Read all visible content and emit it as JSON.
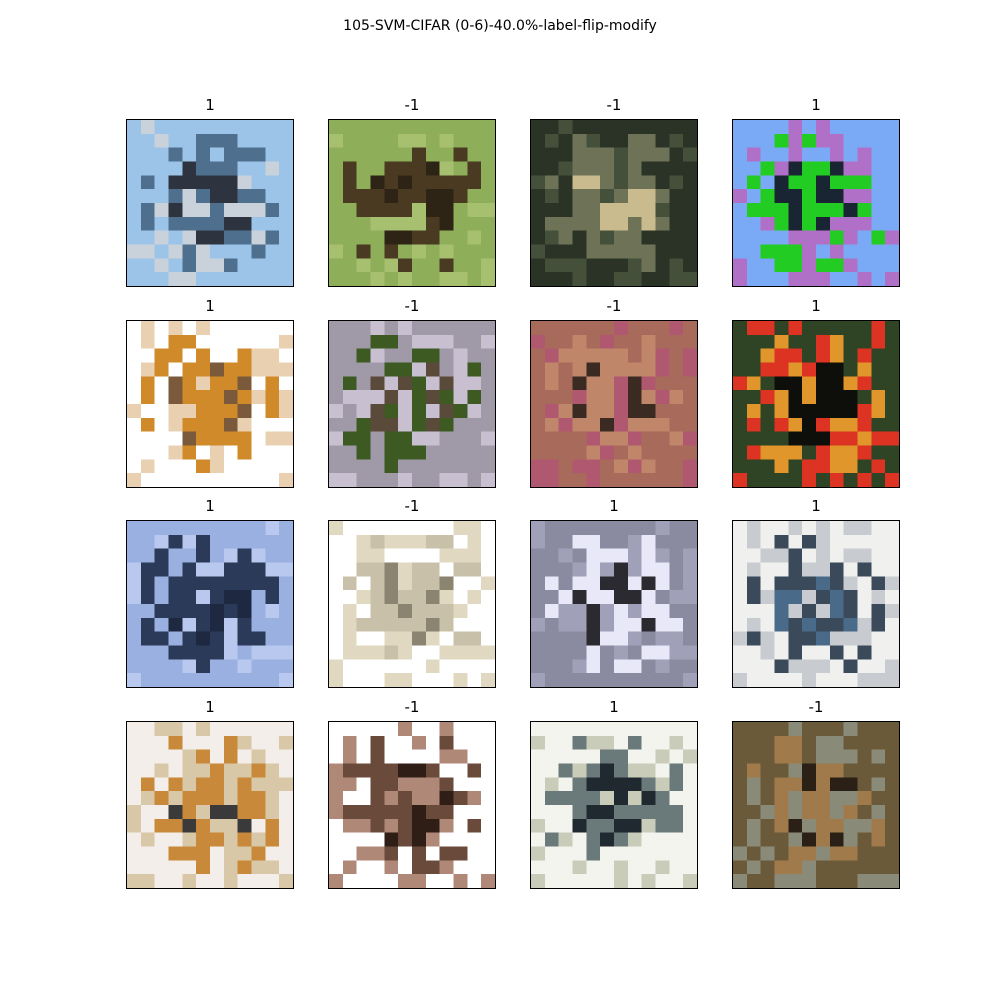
{
  "figure": {
    "title": "105-SVM-CIFAR (0-6)-40.0%-label-flip-modify"
  },
  "panels": [
    {
      "label": "1",
      "icon": "airplane-on-tarmac-image",
      "colors": [
        "#9bc4e8",
        "#4f6f8f",
        "#2d3440",
        "#c9d2da"
      ]
    },
    {
      "label": "-1",
      "icon": "frog-on-grass-image",
      "colors": [
        "#8fae5a",
        "#4a3a22",
        "#2e2416",
        "#a7c070"
      ]
    },
    {
      "label": "-1",
      "icon": "frog-camouflaged-image",
      "colors": [
        "#2a3326",
        "#6e7358",
        "#c9bb8e",
        "#44503a"
      ]
    },
    {
      "label": "1",
      "icon": "green-bird-sky-image",
      "colors": [
        "#7aaaf5",
        "#22cc22",
        "#1a2533",
        "#b070c8"
      ]
    },
    {
      "label": "1",
      "icon": "airplane-white-sky-image",
      "colors": [
        "#ffffff",
        "#d08a2a",
        "#7a5a3a",
        "#e8d0b0"
      ]
    },
    {
      "label": "-1",
      "icon": "frog-mottled-image",
      "colors": [
        "#a09aa8",
        "#3d5a22",
        "#5a4a3a",
        "#c8c0d0"
      ]
    },
    {
      "label": "-1",
      "icon": "frog-brown-pink-image",
      "colors": [
        "#a86a5a",
        "#c0866a",
        "#3a2a22",
        "#b05870"
      ]
    },
    {
      "label": "1",
      "icon": "colorful-bird-image",
      "colors": [
        "#2e4424",
        "#e0962a",
        "#0e0e0a",
        "#dd3322"
      ]
    },
    {
      "label": "1",
      "icon": "jet-airplane-image",
      "colors": [
        "#9ab0e0",
        "#2a3a58",
        "#1e2840",
        "#b8c8ee"
      ]
    },
    {
      "label": "-1",
      "icon": "frog-flat-beige-image",
      "colors": [
        "#ffffff",
        "#c8c0a8",
        "#8a8470",
        "#e0d8c0"
      ]
    },
    {
      "label": "1",
      "icon": "airplane-grey-image",
      "colors": [
        "#8a8aa0",
        "#e8e8f8",
        "#2a2a30",
        "#a0a0b8"
      ]
    },
    {
      "label": "1",
      "icon": "airplane-ground-image",
      "colors": [
        "#f0f0ee",
        "#3a4a5a",
        "#4a6a8a",
        "#c8ccd0"
      ]
    },
    {
      "label": "1",
      "icon": "airplane-desert-image",
      "colors": [
        "#f4eeea",
        "#c88a3a",
        "#3a3a3a",
        "#d8c8a8"
      ]
    },
    {
      "label": "-1",
      "icon": "frog-dark-brown-image",
      "colors": [
        "#ffffff",
        "#6a4a3a",
        "#2e1e16",
        "#b08878"
      ]
    },
    {
      "label": "1",
      "icon": "airplane-front-image",
      "colors": [
        "#f4f4ee",
        "#6a7a7a",
        "#202830",
        "#c8ccb8"
      ]
    },
    {
      "label": "-1",
      "icon": "frog-brown-texture-image",
      "colors": [
        "#6a5a3a",
        "#a07a4a",
        "#2a2016",
        "#8a8a78"
      ]
    }
  ]
}
